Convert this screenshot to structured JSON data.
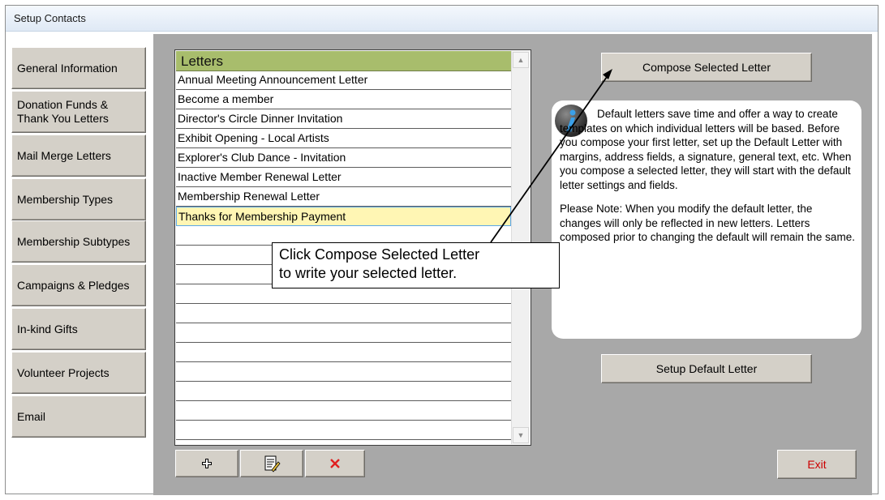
{
  "window": {
    "title": "Setup Contacts"
  },
  "sidebar": {
    "items": [
      {
        "label": "General Information"
      },
      {
        "label": "Donation Funds & Thank You Letters"
      },
      {
        "label": "Mail Merge Letters"
      },
      {
        "label": "Membership Types"
      },
      {
        "label": "Membership Subtypes"
      },
      {
        "label": "Campaigns & Pledges"
      },
      {
        "label": "In-kind Gifts"
      },
      {
        "label": "Volunteer Projects"
      },
      {
        "label": "Email"
      }
    ]
  },
  "letters": {
    "header": "Letters",
    "rows": [
      "Annual Meeting Announcement Letter",
      "Become a member",
      "Director's Circle Dinner Invitation",
      "Exhibit Opening - Local Artists",
      "Explorer's Club Dance - Invitation",
      "Inactive Member Renewal Letter",
      "Membership Renewal Letter",
      "Thanks for Membership Payment"
    ],
    "selected_row": "Thanks for Membership Payment"
  },
  "toolbar": {
    "add_icon": "plus-icon",
    "edit_icon": "document-edit-icon",
    "delete_icon": "delete-x-icon",
    "delete_color": "#e02020"
  },
  "actions": {
    "compose_label": "Compose Selected Letter",
    "setup_default_label": "Setup Default Letter",
    "exit_label": "Exit",
    "exit_color": "#cc0000"
  },
  "info": {
    "icon": "info-icon",
    "paragraph1": "Default letters save time and offer a way to create templates on which individual letters will be based. Before you compose your first letter, set up the Default Letter with margins, address fields, a signature, general text, etc. When you compose a selected letter, they will start with the default letter settings and fields.",
    "paragraph2": "Please Note:  When you modify the default letter, the changes will only be reflected in new letters. Letters composed prior to changing the default will remain the same."
  },
  "callout": {
    "line1": "Click Compose Selected Letter",
    "line2": "to write your selected letter."
  },
  "colors": {
    "header_green": "#a8bd6c",
    "panel_gray": "#a8a8a8",
    "selected_row": "#fff6b4"
  }
}
